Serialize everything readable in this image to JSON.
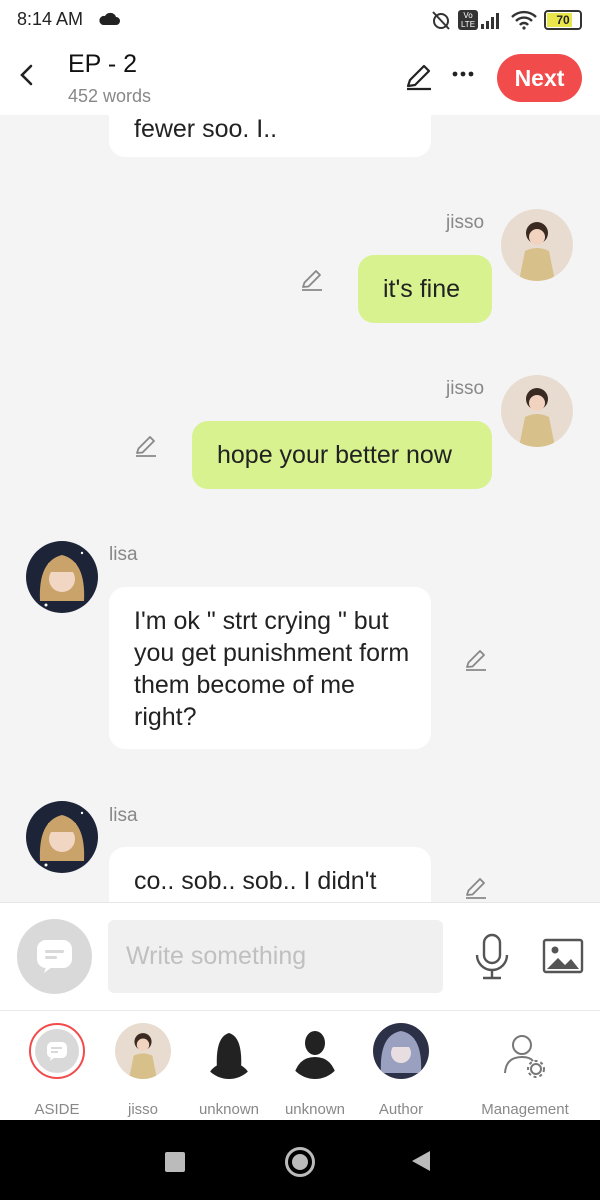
{
  "status_bar": {
    "time": "8:14 AM",
    "battery": "70",
    "icons": [
      "cloud-icon",
      "alarm-off-icon",
      "volte-icon",
      "signal-icon",
      "wifi-icon",
      "battery-icon"
    ]
  },
  "header": {
    "title": "EP - 2",
    "word_count": "452 words",
    "next_label": "Next",
    "accent": "#f24b4b"
  },
  "chat": {
    "messages": [
      {
        "sender": "",
        "side": "left",
        "text": "fewer soo. I.."
      },
      {
        "sender": "jisso",
        "side": "right",
        "text": "it's fine"
      },
      {
        "sender": "jisso",
        "side": "right",
        "text": "hope your better now"
      },
      {
        "sender": "lisa",
        "side": "left",
        "text": "I'm ok \" strt crying \" but you get punishment form them become of me right?"
      },
      {
        "sender": "lisa",
        "side": "left",
        "text": "co.. sob.. sob.. I didn't"
      }
    ],
    "my_bubble_color": "#d7f28f",
    "other_bubble_color": "#ffffff"
  },
  "input": {
    "placeholder": "Write something"
  },
  "roles": [
    {
      "label": "ASIDE"
    },
    {
      "label": "jisso"
    },
    {
      "label": "unknown"
    },
    {
      "label": "unknown"
    },
    {
      "label": "Author"
    },
    {
      "label": "Management"
    }
  ]
}
